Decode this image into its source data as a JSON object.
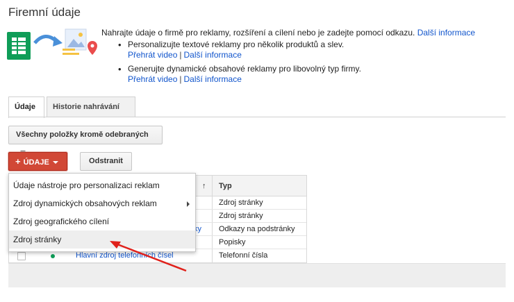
{
  "page": {
    "title": "Firemní údaje"
  },
  "intro": {
    "lead_text": "Nahrajte údaje o firmě pro reklamy, rozšíření a cílení nebo je zadejte pomocí odkazu.",
    "lead_link": "Další informace",
    "bullets": [
      {
        "text": "Personalizujte textové reklamy pro několik produktů a slev.",
        "video_link": "Přehrát video",
        "separator": "|",
        "info_link": "Další informace"
      },
      {
        "text": "Generujte dynamické obsahové reklamy pro libovolný typ firmy.",
        "video_link": "Přehrát video",
        "separator": "|",
        "info_link": "Další informace"
      }
    ],
    "icons": [
      "spreadsheet-icon",
      "curved-arrow-icon",
      "image-document-icon",
      "map-pin-icon"
    ]
  },
  "tabs": [
    {
      "label": "Údaje",
      "active": true
    },
    {
      "label": "Historie nahrávání",
      "active": false
    }
  ],
  "filter": {
    "label": "Všechny položky kromě odebraných"
  },
  "toolbar": {
    "add_label": "ÚDAJE",
    "add_icon": "+",
    "delete_label": "Odstranit"
  },
  "table": {
    "sort_arrow": "↑",
    "type_header": "Typ",
    "rows": [
      {
        "name": "",
        "type": "Zdroj stránky"
      },
      {
        "name": "",
        "type": "Zdroj stránky"
      },
      {
        "name": "ky",
        "type": "Odkazy na podstránky"
      },
      {
        "name": "",
        "type": "Popisky"
      },
      {
        "name": "Hlavní zdroj telefonních čísel",
        "type": "Telefonní čísla"
      }
    ]
  },
  "menu": {
    "items": [
      {
        "label": "Údaje nástroje pro personalizaci reklam",
        "has_submenu": false
      },
      {
        "label": "Zdroj dynamických obsahových reklam",
        "has_submenu": true
      },
      {
        "label": "Zdroj geografického cílení",
        "has_submenu": false
      },
      {
        "label": "Zdroj stránky",
        "has_submenu": false,
        "highlighted": true
      }
    ]
  },
  "colors": {
    "accent_red": "#d14836",
    "link_blue": "#1155cc",
    "status_green": "#0f9d58",
    "annotation_arrow": "#e0201a"
  }
}
